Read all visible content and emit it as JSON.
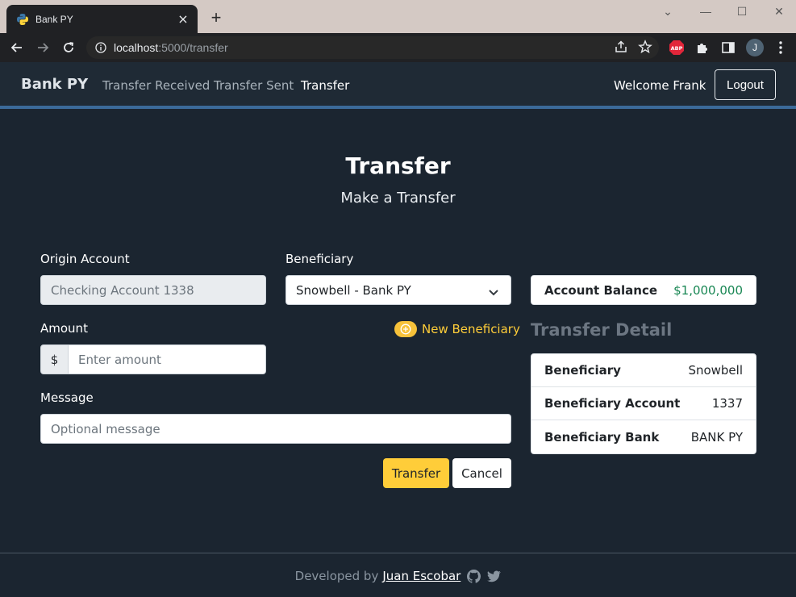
{
  "browser": {
    "tab_title": "Bank PY",
    "tab_close": "×",
    "new_tab": "+",
    "url_host": "localhost",
    "url_rest": ":5000/transfer",
    "window_controls": {
      "dropdown": "⌄",
      "minimize": "—",
      "maximize": "☐",
      "close": "✕"
    },
    "profile_initial": "J",
    "abp_label": "ABP"
  },
  "navbar": {
    "brand": "Bank PY",
    "links": [
      {
        "label": "Transfer Received",
        "active": false
      },
      {
        "label": "Transfer Sent",
        "active": false
      },
      {
        "label": "Transfer",
        "active": true
      }
    ],
    "welcome": "Welcome Frank",
    "logout_label": "Logout"
  },
  "page": {
    "title": "Transfer",
    "subtitle": "Make a Transfer"
  },
  "form": {
    "origin_label": "Origin Account",
    "origin_value": "Checking Account 1338",
    "beneficiary_label": "Beneficiary",
    "beneficiary_value": "Snowbell - Bank PY",
    "new_beneficiary_label": "New Beneficiary",
    "amount_label": "Amount",
    "currency_symbol": "$",
    "amount_placeholder": "Enter amount",
    "message_label": "Message",
    "message_placeholder": "Optional message",
    "submit_label": "Transfer",
    "cancel_label": "Cancel"
  },
  "balance": {
    "label": "Account Balance",
    "value": "$1,000,000"
  },
  "detail": {
    "title": "Transfer Detail",
    "rows": [
      {
        "key": "Beneficiary",
        "value": "Snowbell"
      },
      {
        "key": "Beneficiary Account",
        "value": "1337"
      },
      {
        "key": "Beneficiary Bank",
        "value": "BANK PY"
      }
    ]
  },
  "footer": {
    "prefix": "Developed by",
    "author": "Juan Escobar"
  },
  "colors": {
    "accent": "#ffcd39",
    "balance": "#198754",
    "navbar_border": "#3b6a99",
    "background": "#1b2530"
  },
  "icons": [
    "python-favicon-icon",
    "back-arrow-icon",
    "forward-arrow-icon",
    "reload-icon",
    "info-icon",
    "share-icon",
    "star-icon",
    "puzzle-icon",
    "sidepanel-icon",
    "more-icon",
    "chevron-down-icon",
    "plus-circle-icon",
    "github-icon",
    "twitter-icon"
  ]
}
